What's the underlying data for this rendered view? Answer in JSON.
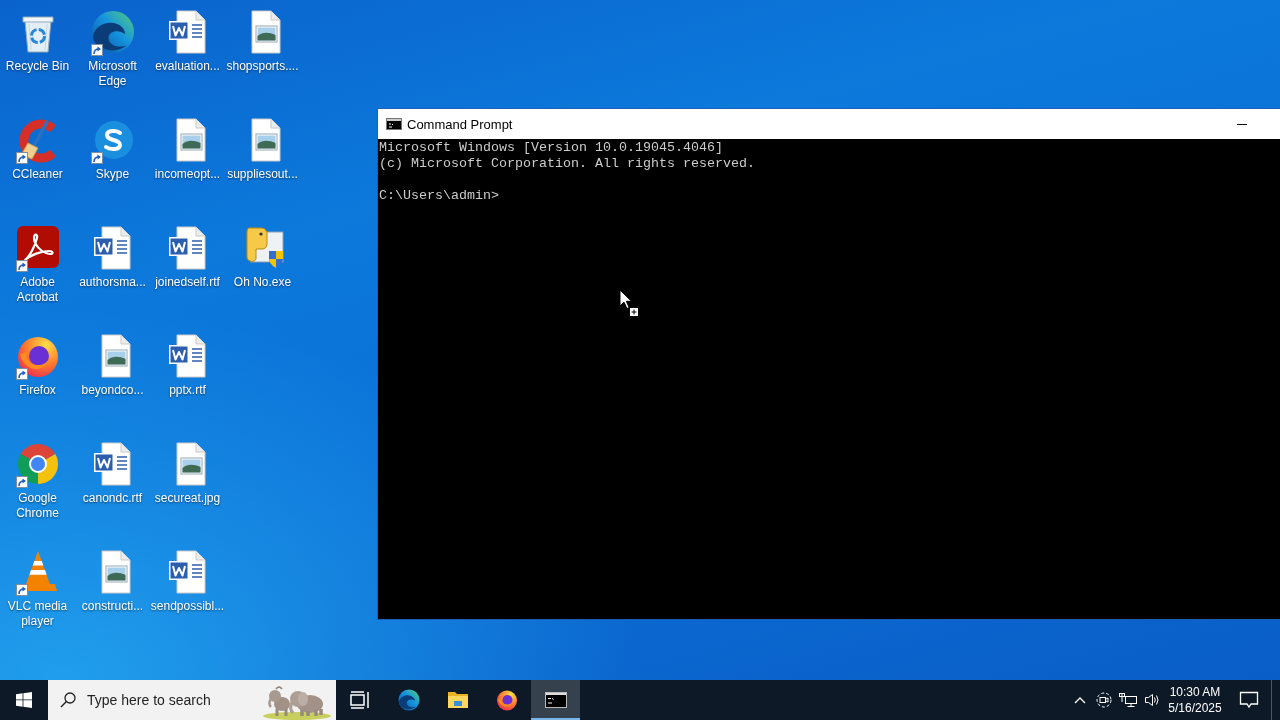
{
  "desktop_icons": [
    {
      "label": "Recycle Bin",
      "kind": "recycle-bin",
      "shortcut": false
    },
    {
      "label": "CCleaner",
      "kind": "ccleaner",
      "shortcut": true
    },
    {
      "label": "Adobe Acrobat",
      "kind": "acrobat",
      "shortcut": true
    },
    {
      "label": "Firefox",
      "kind": "firefox",
      "shortcut": true
    },
    {
      "label": "Google Chrome",
      "kind": "chrome",
      "shortcut": true
    },
    {
      "label": "VLC media player",
      "kind": "vlc",
      "shortcut": true
    },
    {
      "label": "Microsoft Edge",
      "kind": "edge",
      "shortcut": true
    },
    {
      "label": "Skype",
      "kind": "skype",
      "shortcut": true
    },
    {
      "label": "authorsma...",
      "kind": "word",
      "shortcut": false
    },
    {
      "label": "beyondco...",
      "kind": "image",
      "shortcut": false
    },
    {
      "label": "canondc.rtf",
      "kind": "word",
      "shortcut": false
    },
    {
      "label": "constructi...",
      "kind": "image",
      "shortcut": false
    },
    {
      "label": "evaluation...",
      "kind": "word",
      "shortcut": false
    },
    {
      "label": "incomeopt...",
      "kind": "image",
      "shortcut": false
    },
    {
      "label": "joinedself.rtf",
      "kind": "word",
      "shortcut": false
    },
    {
      "label": "pptx.rtf",
      "kind": "word",
      "shortcut": false
    },
    {
      "label": "secureat.jpg",
      "kind": "image",
      "shortcut": false
    },
    {
      "label": "sendpossibl...",
      "kind": "word",
      "shortcut": false
    },
    {
      "label": "shopsports....",
      "kind": "image",
      "shortcut": false
    },
    {
      "label": "suppliesout...",
      "kind": "image",
      "shortcut": false
    },
    {
      "label": "Oh No.exe",
      "kind": "exe",
      "shortcut": false
    }
  ],
  "window": {
    "title": "Command Prompt",
    "output": [
      "Microsoft Windows [Version 10.0.19045.4046]",
      "(c) Microsoft Corporation. All rights reserved."
    ],
    "prompt": "C:\\Users\\admin>"
  },
  "taskbar": {
    "search": {
      "placeholder": "Type here to search"
    },
    "buttons": [
      {
        "kind": "task-view",
        "active": false
      },
      {
        "kind": "edge",
        "active": false
      },
      {
        "kind": "file-explorer",
        "active": false
      },
      {
        "kind": "firefox",
        "active": false
      },
      {
        "kind": "command-prompt",
        "active": true
      }
    ],
    "clock": {
      "time": "10:30 AM",
      "date": "5/16/2025"
    }
  }
}
